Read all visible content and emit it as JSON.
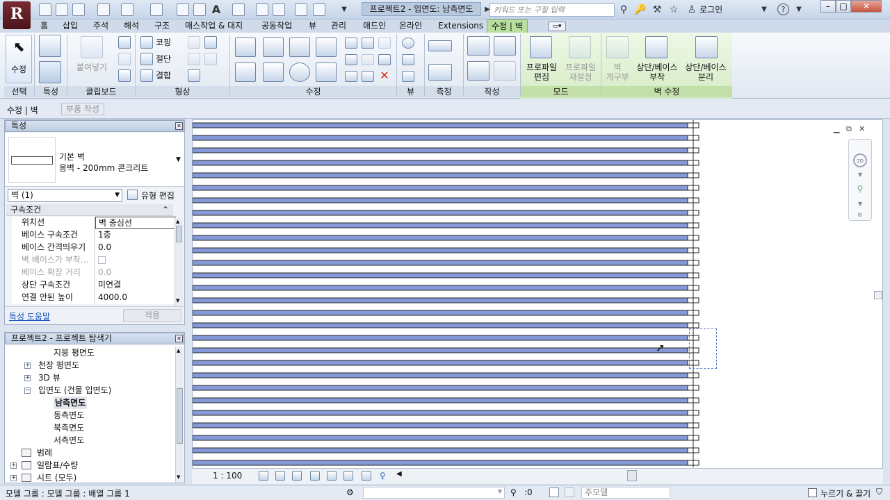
{
  "app": {
    "logo_letter": "R"
  },
  "title": {
    "document": "프로젝트2 - 입면도: 남측면도",
    "search_placeholder": "키워드 또는 구절 입력",
    "login": "로그인",
    "help": "?"
  },
  "tabs": [
    "홈",
    "삽입",
    "주석",
    "해석",
    "구조",
    "매스작업 & 대지",
    "공동작업",
    "뷰",
    "관리",
    "애드인",
    "온라인",
    "Extensions",
    "수정 | 벽"
  ],
  "active_tab": "수정 | 벽",
  "ribbon": {
    "select_big": "수정",
    "panels": {
      "select": "선택",
      "properties": "특성",
      "clipboard": "클립보드",
      "geometry": "형상",
      "modify": "수정",
      "view": "뷰",
      "measure": "측정",
      "create": "작성",
      "mode": "모드",
      "modify_wall": "벽 수정"
    },
    "paste": "붙여넣기",
    "cope": "코핑",
    "cut": "절단",
    "join": "결합",
    "edit_profile": [
      "프로파일",
      "편집"
    ],
    "reset_profile": [
      "프로파일",
      "재설정"
    ],
    "wall_opening": [
      "벽",
      "개구부"
    ],
    "attach_top_base": [
      "상단/베이스",
      "부착"
    ],
    "detach_top_base": [
      "상단/베이스",
      "분리"
    ]
  },
  "options_bar": {
    "context": "수정 | 벽",
    "create_parts": "부품 작성"
  },
  "properties": {
    "header": "특성",
    "type_family": "기본 벽",
    "type_name": "옹벽 - 200mm 콘크리트",
    "instance_filter": "벽 (1)",
    "edit_type": "유형 편집",
    "group": "구속조건",
    "rows": [
      {
        "key": "위치선",
        "value": "벽 중심선",
        "disabled": false,
        "checkbox": false
      },
      {
        "key": "베이스 구속조건",
        "value": "1층",
        "disabled": false,
        "checkbox": false
      },
      {
        "key": "베이스 간격띄우기",
        "value": "0.0",
        "disabled": false,
        "checkbox": false
      },
      {
        "key": "벽 베이스가 부착...",
        "value": "",
        "disabled": true,
        "checkbox": true
      },
      {
        "key": "베이스 확장 거리",
        "value": "0.0",
        "disabled": true,
        "checkbox": false
      },
      {
        "key": "상단 구속조건",
        "value": "미연결",
        "disabled": false,
        "checkbox": false
      },
      {
        "key": "연결 안된 높이",
        "value": "4000.0",
        "disabled": false,
        "checkbox": false
      }
    ],
    "help_link": "특성 도움말",
    "apply": "적용"
  },
  "browser": {
    "header": "프로젝트2 - 프로젝트 탐색기",
    "items": [
      {
        "label": "지붕 평면도",
        "level": 3,
        "toggle": "",
        "icon": false,
        "bold": false
      },
      {
        "label": "천장 평면도",
        "level": 1,
        "toggle": "+",
        "icon": false,
        "bold": false
      },
      {
        "label": "3D 뷰",
        "level": 1,
        "toggle": "+",
        "icon": false,
        "bold": false
      },
      {
        "label": "입면도 (건물 입면도)",
        "level": 1,
        "toggle": "−",
        "icon": false,
        "bold": false
      },
      {
        "label": "남측면도",
        "level": 2,
        "toggle": "",
        "icon": false,
        "bold": true
      },
      {
        "label": "동측면도",
        "level": 2,
        "toggle": "",
        "icon": false,
        "bold": false
      },
      {
        "label": "북측면도",
        "level": 2,
        "toggle": "",
        "icon": false,
        "bold": false
      },
      {
        "label": "서측면도",
        "level": 2,
        "toggle": "",
        "icon": false,
        "bold": false
      },
      {
        "label": "범례",
        "level": 0,
        "toggle": "",
        "icon": true,
        "bold": false
      },
      {
        "label": "일람표/수량",
        "level": 0,
        "toggle": "+",
        "icon": true,
        "bold": false
      },
      {
        "label": "시트 (모두)",
        "level": 0,
        "toggle": "+",
        "icon": true,
        "bold": false
      }
    ]
  },
  "view_control": {
    "scale": "1 : 100"
  },
  "status": {
    "message": "모델 그룹 : 모델 그룹 : 배열 그룹 1",
    "selection_count": ":0",
    "model": "주모델",
    "press_drag": "누르기 & 끌기"
  },
  "colors": {
    "wall_fill": "#8599d8",
    "selection_border": "#5b77c7",
    "ribbon_context": "#b8df9d",
    "title_bg": "#c6d5e8"
  }
}
